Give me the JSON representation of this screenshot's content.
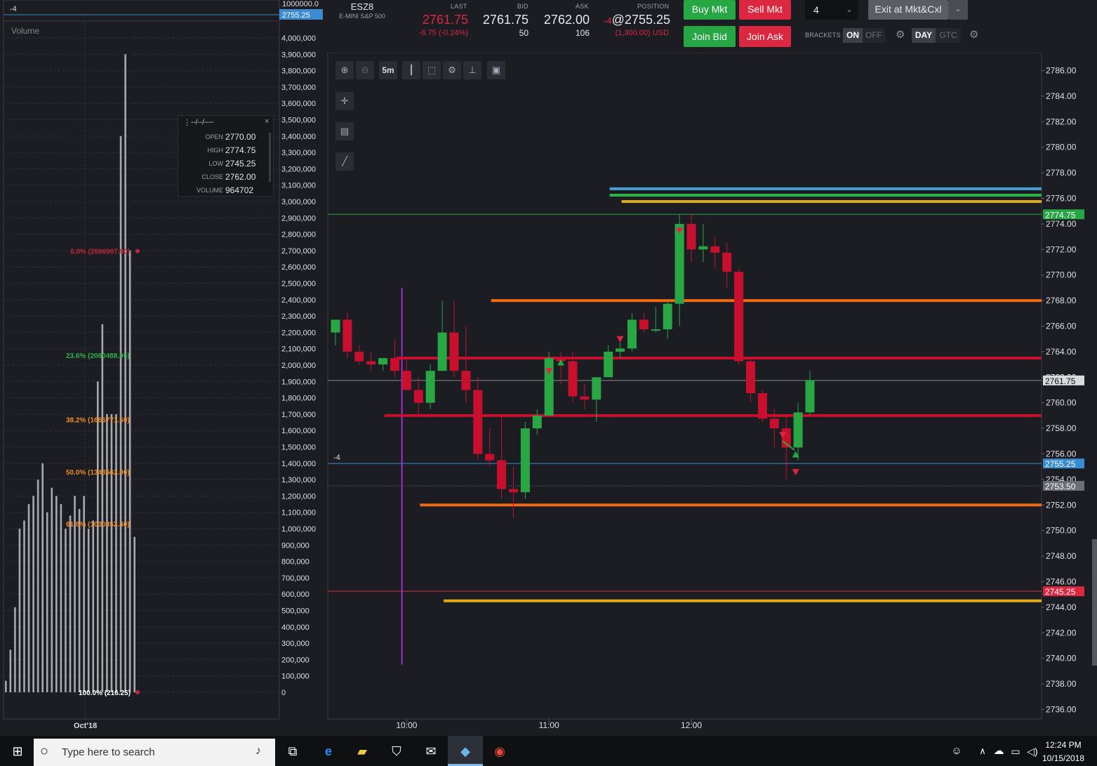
{
  "left_panel": {
    "position_marker": "-4",
    "price_tag": "2755.25",
    "top_value": "1000000.0",
    "title": "Volume",
    "date_label": "Oct'18",
    "axis_labels": [
      "4,000,000",
      "3,900,000",
      "3,800,000",
      "3,700,000",
      "3,600,000",
      "3,500,000",
      "3,400,000",
      "3,300,000",
      "3,200,000",
      "3,100,000",
      "3,000,000",
      "2,900,000",
      "2,800,000",
      "2,700,000",
      "2,600,000",
      "2,500,000",
      "2,400,000",
      "2,300,000",
      "2,200,000",
      "2,100,000",
      "2,000,000",
      "1,900,000",
      "1,800,000",
      "1,700,000",
      "1,600,000",
      "1,500,000",
      "1,400,000",
      "1,300,000",
      "1,200,000",
      "1,100,000",
      "1,000,000",
      "900,000",
      "800,000",
      "700,000",
      "600,000",
      "500,000",
      "400,000",
      "300,000",
      "200,000",
      "100,000",
      "0"
    ],
    "volume_bars": [
      70000,
      260000,
      520000,
      1000000,
      1050000,
      1150000,
      1200000,
      1300000,
      1400000,
      1100000,
      1250000,
      1200000,
      1150000,
      1000000,
      1080000,
      1200000,
      1120000,
      1200000,
      1000000,
      1050000,
      1900000,
      2250000,
      1700000,
      1700000,
      1700000,
      3400000,
      3900000,
      2700000,
      950000
    ],
    "fib_levels": [
      {
        "label": "0.0% (2696907.90)",
        "color": "#c0283c",
        "value": 2696907.9
      },
      {
        "label": "23.6% (2060488.95)",
        "color": "#2fb04a",
        "value": 2060488.95
      },
      {
        "label": "38.2% (1666771.59)",
        "color": "#f08a24",
        "value": 1666771.59
      },
      {
        "label": "50.0% (1348562.00)",
        "color": "#f08a24",
        "value": 1348562.0
      },
      {
        "label": "61.8% (1030352.40)",
        "color": "#f08a24",
        "value": 1030352.4
      },
      {
        "label": "100.0% (216.25)",
        "color": "#ffffff",
        "value": 216.25
      }
    ],
    "ohlc_panel": {
      "title": "--/--/----",
      "close_icon": "×",
      "rows": [
        {
          "k": "OPEN",
          "v": "2770.00"
        },
        {
          "k": "HIGH",
          "v": "2774.75"
        },
        {
          "k": "LOW",
          "v": "2745.25"
        },
        {
          "k": "CLOSE",
          "v": "2762.00"
        },
        {
          "k": "VOLUME",
          "v": "964702"
        }
      ]
    }
  },
  "ticker": {
    "symbol": "ESZ8",
    "name": "E-MINI S&P 500",
    "last_label": "LAST",
    "last": "2761.75",
    "change": "-6.75 (-0.24%)",
    "bid_label": "BID",
    "bid": "2761.75",
    "bid_size": "50",
    "ask_label": "ASK",
    "ask": "2762.00",
    "ask_size": "106",
    "position_label": "POSITION",
    "position_qty": "-4",
    "position_price": "@2755.25",
    "position_pnl": "(1,300.00) USD"
  },
  "trade": {
    "buy_mkt": "Buy Mkt",
    "sell_mkt": "Sell Mkt",
    "join_bid": "Join Bid",
    "join_ask": "Join Ask",
    "quantity": "4",
    "exit": "Exit at Mkt&Cxl",
    "brackets_label": "BRACKETS",
    "on": "ON",
    "off": "OFF",
    "day": "DAY",
    "gtc": "GTC"
  },
  "toolbar": {
    "interval": "5m"
  },
  "chart_data": {
    "type": "candlestick",
    "symbol": "ESZ8",
    "x_ticks": [
      "10:00",
      "11:00",
      "12:00"
    ],
    "y_ticks": [
      "2786.00",
      "2784.00",
      "2782.00",
      "2780.00",
      "2778.00",
      "2776.00",
      "2774.00",
      "2772.00",
      "2770.00",
      "2768.00",
      "2766.00",
      "2764.00",
      "2762.00",
      "2760.00",
      "2758.00",
      "2756.00",
      "2754.00",
      "2752.00",
      "2750.00",
      "2748.00",
      "2746.00",
      "2744.00",
      "2742.00",
      "2740.00",
      "2738.00",
      "2736.00"
    ],
    "ylim": [
      2735,
      2787.5
    ],
    "candles": [
      {
        "t": "09:30",
        "o": 2765.5,
        "h": 2766.0,
        "l": 2764.5,
        "c": 2766.5
      },
      {
        "t": "09:35",
        "o": 2766.5,
        "h": 2767.0,
        "l": 2763.5,
        "c": 2764.0
      },
      {
        "t": "09:40",
        "o": 2764.0,
        "h": 2764.5,
        "l": 2763.0,
        "c": 2763.25
      },
      {
        "t": "09:45",
        "o": 2763.25,
        "h": 2764.0,
        "l": 2762.5,
        "c": 2763.0
      },
      {
        "t": "09:50",
        "o": 2763.0,
        "h": 2763.5,
        "l": 2762.5,
        "c": 2763.5
      },
      {
        "t": "09:55",
        "o": 2763.5,
        "h": 2765.0,
        "l": 2762.0,
        "c": 2762.5
      },
      {
        "t": "10:00a",
        "o": 2762.5,
        "h": 2763.5,
        "l": 2761.0,
        "c": 2761.0
      },
      {
        "t": "10:05",
        "o": 2761.0,
        "h": 2762.0,
        "l": 2759.0,
        "c": 2760.0
      },
      {
        "t": "10:10",
        "o": 2760.0,
        "h": 2763.0,
        "l": 2759.5,
        "c": 2762.5
      },
      {
        "t": "10:15",
        "o": 2762.5,
        "h": 2768.0,
        "l": 2762.5,
        "c": 2765.5
      },
      {
        "t": "10:20",
        "o": 2765.5,
        "h": 2768.0,
        "l": 2762.0,
        "c": 2762.5
      },
      {
        "t": "10:25",
        "o": 2762.5,
        "h": 2766.0,
        "l": 2760.0,
        "c": 2761.0
      },
      {
        "t": "10:30",
        "o": 2761.0,
        "h": 2762.0,
        "l": 2755.5,
        "c": 2756.0
      },
      {
        "t": "10:35",
        "o": 2756.0,
        "h": 2758.0,
        "l": 2755.0,
        "c": 2755.5
      },
      {
        "t": "10:40",
        "o": 2755.5,
        "h": 2759.0,
        "l": 2752.5,
        "c": 2753.25
      },
      {
        "t": "10:45",
        "o": 2753.25,
        "h": 2755.0,
        "l": 2751.0,
        "c": 2753.0
      },
      {
        "t": "10:50",
        "o": 2753.0,
        "h": 2758.5,
        "l": 2752.5,
        "c": 2758.0
      },
      {
        "t": "10:55",
        "o": 2758.0,
        "h": 2759.5,
        "l": 2757.5,
        "c": 2759.0
      },
      {
        "t": "11:00a",
        "o": 2759.0,
        "h": 2764.0,
        "l": 2759.0,
        "c": 2763.5
      },
      {
        "t": "11:05",
        "o": 2763.5,
        "h": 2764.0,
        "l": 2761.5,
        "c": 2763.25
      },
      {
        "t": "11:10",
        "o": 2763.25,
        "h": 2764.0,
        "l": 2760.0,
        "c": 2760.5
      },
      {
        "t": "11:15",
        "o": 2760.5,
        "h": 2761.5,
        "l": 2759.5,
        "c": 2760.25
      },
      {
        "t": "11:20",
        "o": 2760.25,
        "h": 2762.0,
        "l": 2758.5,
        "c": 2762.0
      },
      {
        "t": "11:25",
        "o": 2762.0,
        "h": 2764.5,
        "l": 2762.0,
        "c": 2764.0
      },
      {
        "t": "11:30",
        "o": 2764.0,
        "h": 2765.0,
        "l": 2763.5,
        "c": 2764.25
      },
      {
        "t": "11:35",
        "o": 2764.25,
        "h": 2767.0,
        "l": 2764.0,
        "c": 2766.5
      },
      {
        "t": "11:40",
        "o": 2766.5,
        "h": 2767.0,
        "l": 2765.5,
        "c": 2765.75
      },
      {
        "t": "11:45",
        "o": 2765.75,
        "h": 2767.5,
        "l": 2765.5,
        "c": 2765.75
      },
      {
        "t": "11:50",
        "o": 2765.75,
        "h": 2768.0,
        "l": 2765.0,
        "c": 2767.75
      },
      {
        "t": "11:55",
        "o": 2767.75,
        "h": 2774.75,
        "l": 2766.0,
        "c": 2774.0
      },
      {
        "t": "12:00a",
        "o": 2774.0,
        "h": 2774.75,
        "l": 2771.0,
        "c": 2772.0
      },
      {
        "t": "12:05",
        "o": 2772.0,
        "h": 2774.0,
        "l": 2771.0,
        "c": 2772.25
      },
      {
        "t": "12:10",
        "o": 2772.25,
        "h": 2773.0,
        "l": 2770.5,
        "c": 2771.75
      },
      {
        "t": "12:15",
        "o": 2771.75,
        "h": 2772.5,
        "l": 2769.0,
        "c": 2770.25
      },
      {
        "t": "12:20",
        "o": 2770.25,
        "h": 2770.5,
        "l": 2763.0,
        "c": 2763.25
      },
      {
        "t": "12:25",
        "o": 2763.25,
        "h": 2763.5,
        "l": 2760.0,
        "c": 2760.75
      },
      {
        "t": "12:30",
        "o": 2760.75,
        "h": 2761.0,
        "l": 2758.5,
        "c": 2758.75
      },
      {
        "t": "12:35",
        "o": 2758.75,
        "h": 2759.5,
        "l": 2756.5,
        "c": 2758.0
      },
      {
        "t": "12:40",
        "o": 2758.0,
        "h": 2759.0,
        "l": 2754.0,
        "c": 2756.5
      },
      {
        "t": "12:45",
        "o": 2756.5,
        "h": 2760.0,
        "l": 2755.5,
        "c": 2759.25
      },
      {
        "t": "12:50",
        "o": 2759.25,
        "h": 2762.5,
        "l": 2759.0,
        "c": 2761.75
      }
    ],
    "hlines": [
      {
        "price": 2776.75,
        "color": "#4a9fd8",
        "from": "11:25"
      },
      {
        "price": 2776.25,
        "color": "#2fb04a",
        "from": "11:25"
      },
      {
        "price": 2775.75,
        "color": "#e0a81a",
        "from": "11:30"
      },
      {
        "price": 2768.0,
        "color": "#f06a14",
        "from": "10:35"
      },
      {
        "price": 2763.5,
        "color": "#c8102e",
        "from": "09:55"
      },
      {
        "price": 2759.0,
        "color": "#c8102e",
        "from": "09:50"
      },
      {
        "price": 2752.0,
        "color": "#f06a14",
        "from": "10:05"
      },
      {
        "price": 2744.5,
        "color": "#e0a81a",
        "from": "10:15"
      }
    ],
    "price_tags": [
      {
        "price": 2774.75,
        "text": "2774.75",
        "bg": "#27a744",
        "fg": "#ffffff"
      },
      {
        "price": 2761.75,
        "text": "2761.75",
        "bg": "#d8dadd",
        "fg": "#111111"
      },
      {
        "price": 2755.25,
        "text": "2755.25",
        "bg": "#3b8bd0",
        "fg": "#ffffff"
      },
      {
        "price": 2753.5,
        "text": "2753.50",
        "bg": "#6b6e74",
        "fg": "#ffffff"
      },
      {
        "price": 2745.25,
        "text": "2745.25",
        "bg": "#dc2741",
        "fg": "#ffffff"
      }
    ],
    "position_marker": "-4",
    "partial_tick": "2762.00"
  },
  "taskbar": {
    "search_placeholder": "Type here to search",
    "time": "12:24 PM",
    "date": "10/15/2018"
  }
}
